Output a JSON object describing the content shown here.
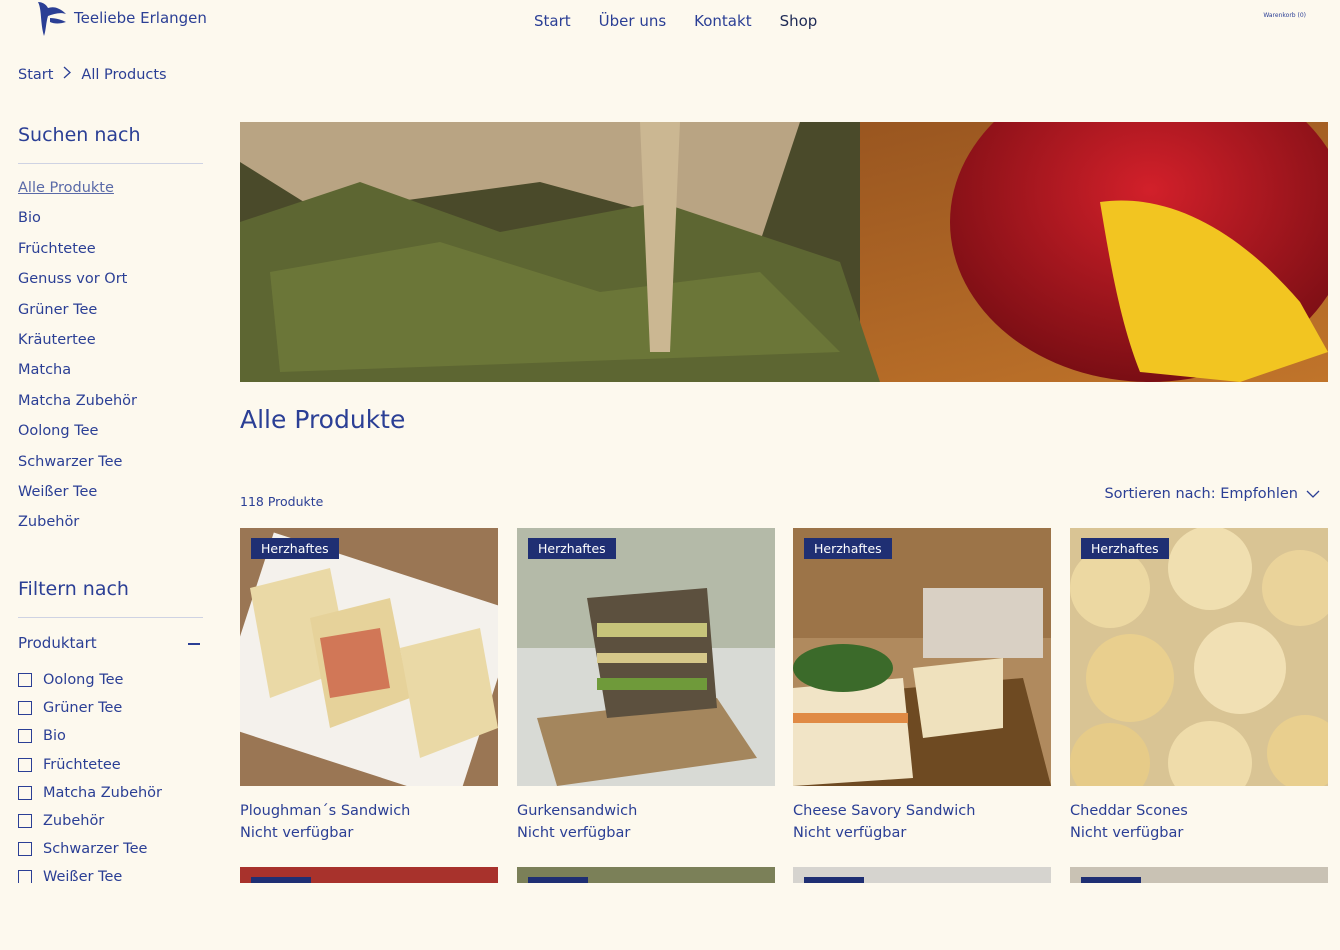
{
  "header": {
    "brand": "Teeliebe Erlangen",
    "nav": [
      "Start",
      "Über uns",
      "Kontakt",
      "Shop"
    ],
    "cart_label": "Warenkorb (0)"
  },
  "breadcrumb": {
    "home": "Start",
    "current": "All Products"
  },
  "sidebar": {
    "search_heading": "Suchen nach",
    "categories": [
      "Alle Produkte",
      "Bio",
      "Früchtetee",
      "Genuss vor Ort",
      "Grüner Tee",
      "Kräutertee",
      "Matcha",
      "Matcha Zubehör",
      "Oolong Tee",
      "Schwarzer Tee",
      "Weißer Tee",
      "Zubehör"
    ],
    "filter_heading": "Filtern nach",
    "filter_group": "Produktart",
    "filter_options": [
      "Oolong Tee",
      "Grüner Tee",
      "Bio",
      "Früchtetee",
      "Matcha Zubehör",
      "Zubehör",
      "Schwarzer Tee",
      "Weißer Tee"
    ]
  },
  "main": {
    "title": "Alle Produkte",
    "count": "118 Produkte",
    "sort": "Sortieren nach: Empfohlen",
    "products": [
      {
        "badge": "Herzhaftes",
        "name": "Ploughman´s Sandwich",
        "status": "Nicht verfügbar"
      },
      {
        "badge": "Herzhaftes",
        "name": "Gurkensandwich",
        "status": "Nicht verfügbar"
      },
      {
        "badge": "Herzhaftes",
        "name": "Cheese Savory Sandwich",
        "status": "Nicht verfügbar"
      },
      {
        "badge": "Herzhaftes",
        "name": "Cheddar Scones",
        "status": "Nicht verfügbar"
      }
    ]
  },
  "colors": {
    "accent": "#2b3f95",
    "badge": "#1f2f73",
    "background": "#fdf9ee"
  }
}
